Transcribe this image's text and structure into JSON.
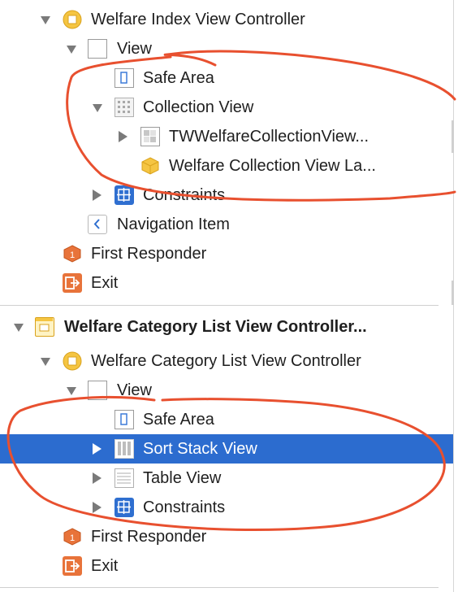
{
  "outline": {
    "rows": [
      {
        "label": "Welfare Index View Controller",
        "icon": "view-controller-icon"
      },
      {
        "label": "View",
        "icon": "view-icon"
      },
      {
        "label": "Safe Area",
        "icon": "safe-area-icon"
      },
      {
        "label": "Collection View",
        "icon": "collection-view-icon"
      },
      {
        "label": "TWWelfareCollectionView...",
        "icon": "collection-cell-icon"
      },
      {
        "label": "Welfare Collection View La...",
        "icon": "layout-object-icon"
      },
      {
        "label": "Constraints",
        "icon": "constraints-icon"
      },
      {
        "label": "Navigation Item",
        "icon": "navigation-item-icon"
      },
      {
        "label": "First Responder",
        "icon": "first-responder-icon"
      },
      {
        "label": "Exit",
        "icon": "exit-icon"
      },
      {
        "label": "Welfare Category List View Controller...",
        "icon": "scene-icon"
      },
      {
        "label": "Welfare Category List View Controller",
        "icon": "view-controller-icon"
      },
      {
        "label": "View",
        "icon": "view-icon"
      },
      {
        "label": "Safe Area",
        "icon": "safe-area-icon"
      },
      {
        "label": "Sort Stack View",
        "icon": "stack-view-icon"
      },
      {
        "label": "Table View",
        "icon": "table-view-icon"
      },
      {
        "label": "Constraints",
        "icon": "constraints-icon"
      },
      {
        "label": "First Responder",
        "icon": "first-responder-icon"
      },
      {
        "label": "Exit",
        "icon": "exit-icon"
      }
    ]
  },
  "colors": {
    "selection": "#2c6ccf",
    "annotation": "#e8502f",
    "controller_yellow": "#f5c542",
    "orange_object": "#e8733a",
    "blue_constraint": "#2f6fd0"
  }
}
